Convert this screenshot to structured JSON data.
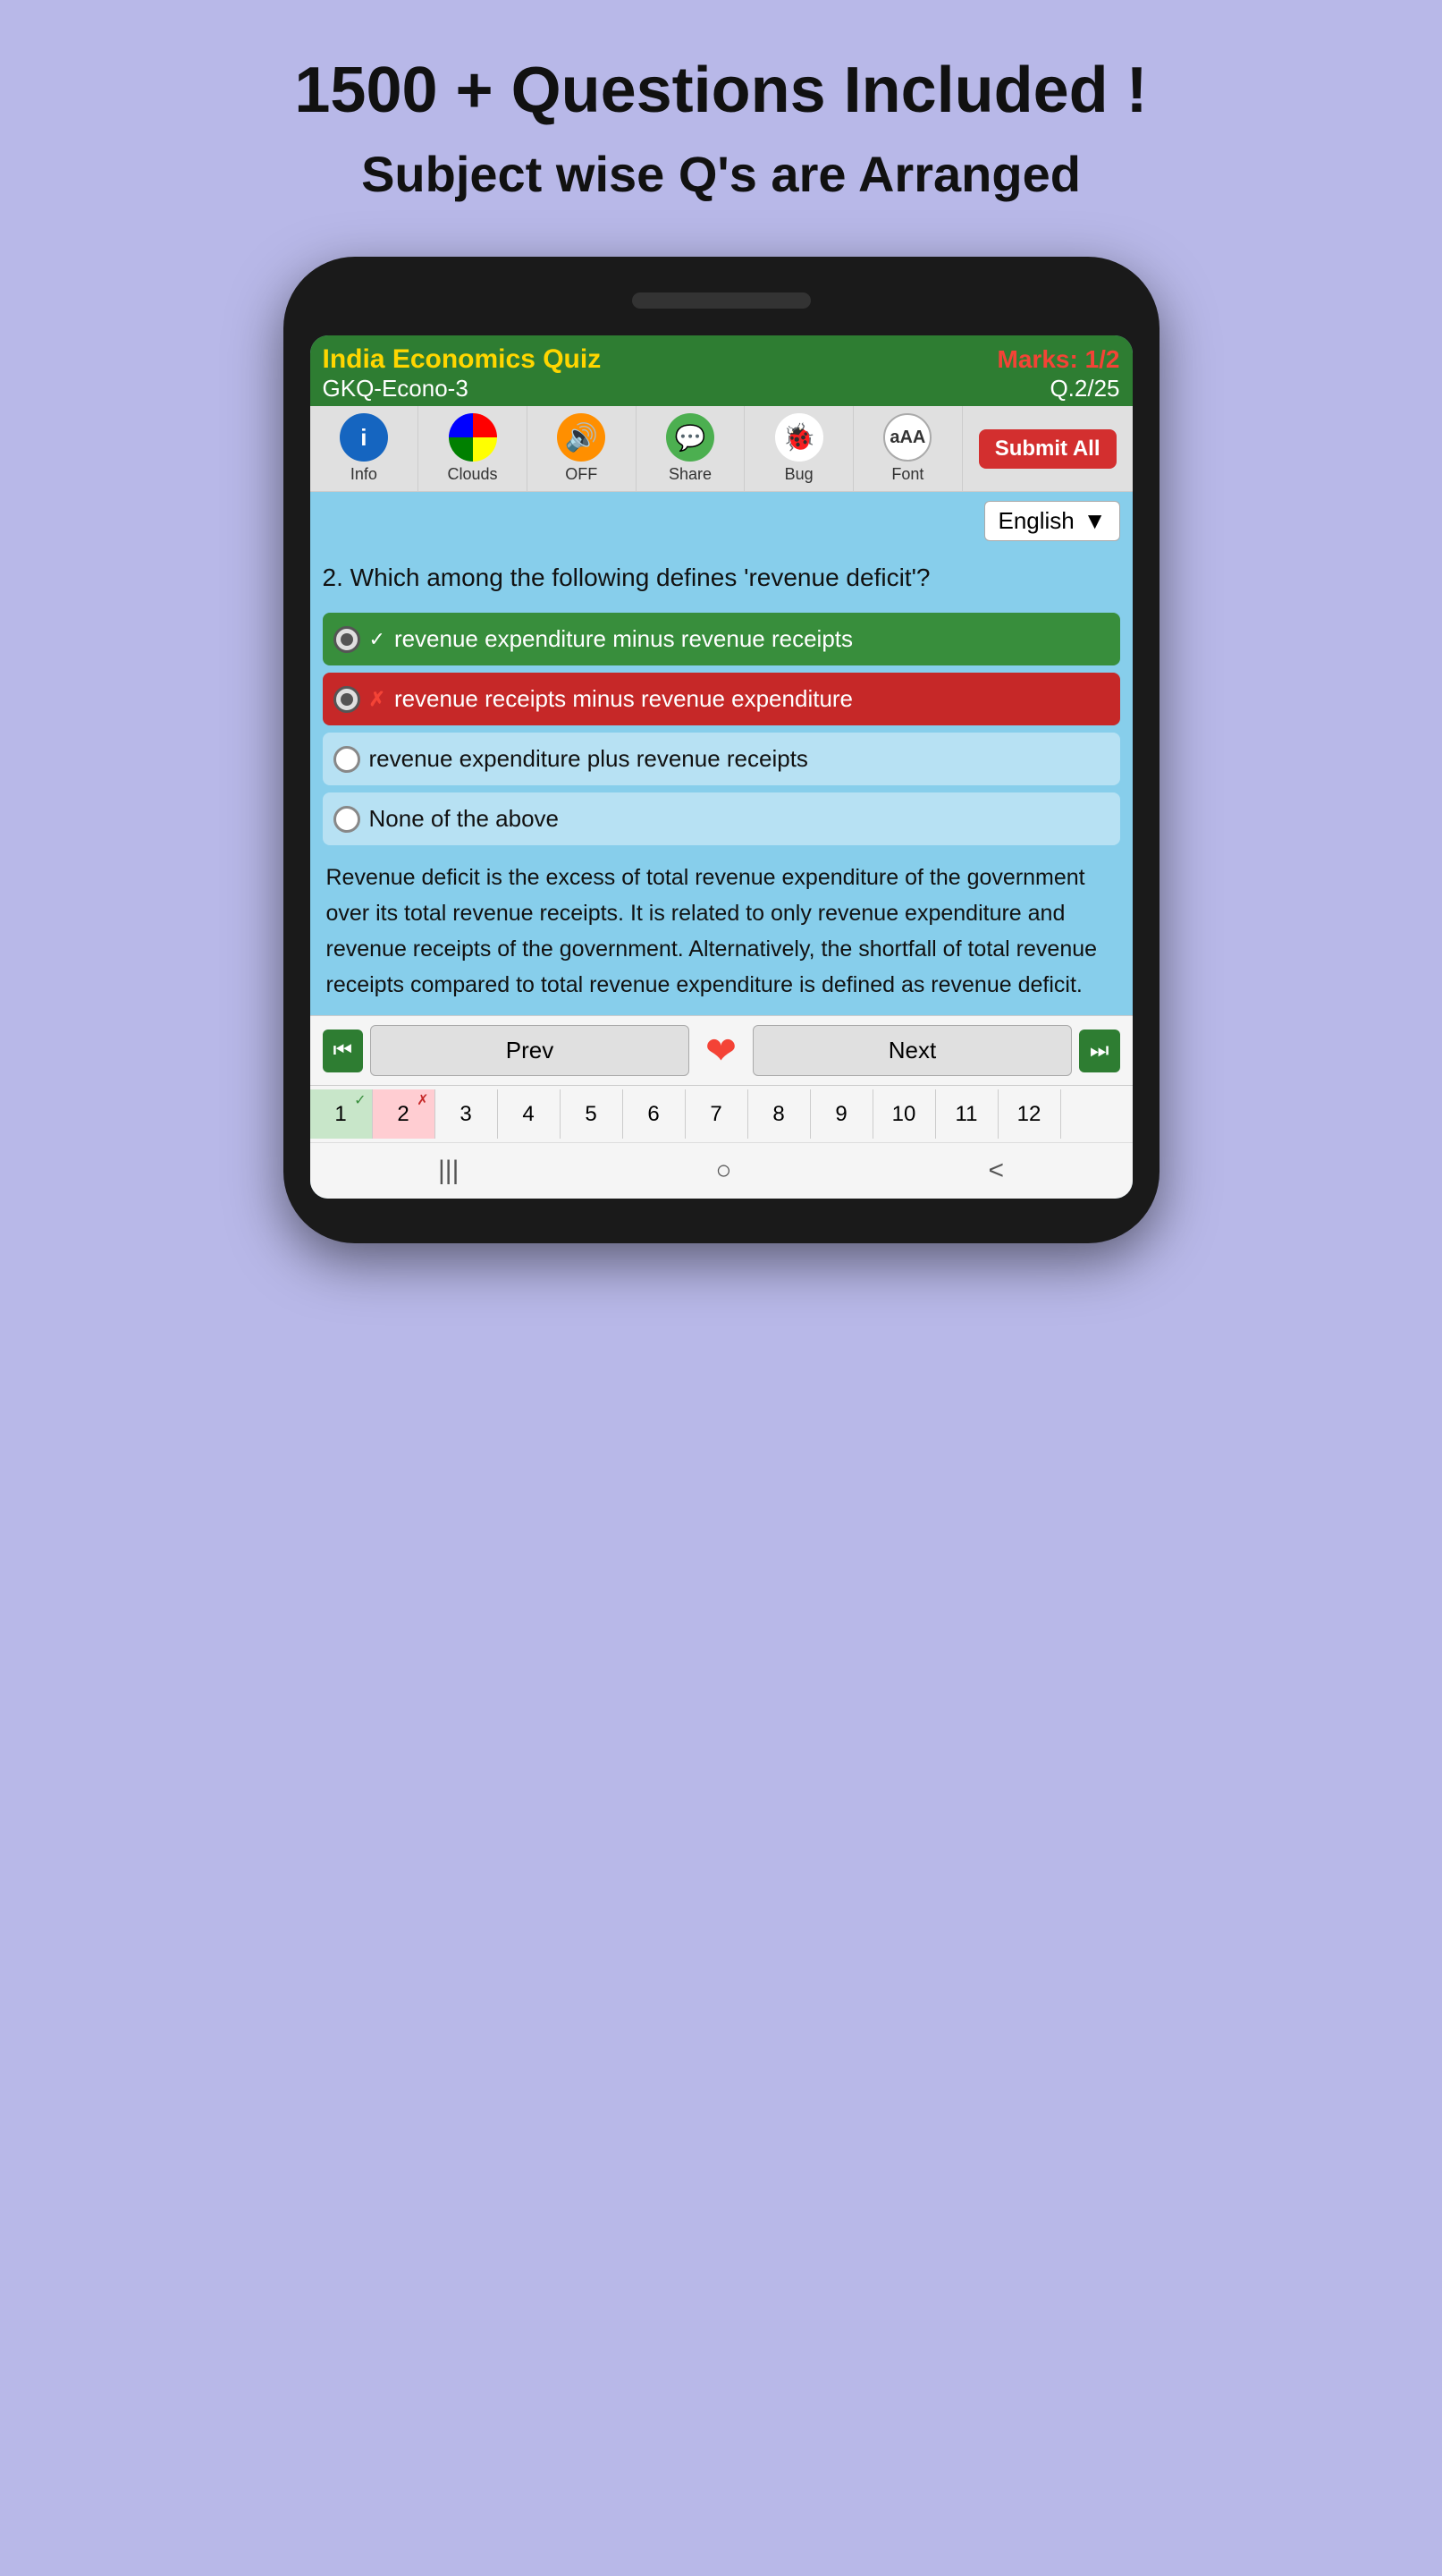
{
  "page": {
    "title": "1500 + Questions Included !",
    "subtitle": "Subject wise Q's are Arranged"
  },
  "header": {
    "quiz_title": "India Economics Quiz",
    "marks_label": "Marks: 1/2",
    "quiz_code": "GKQ-Econo-3",
    "q_progress": "Q.2/25"
  },
  "toolbar": {
    "items": [
      {
        "id": "info",
        "label": "Info"
      },
      {
        "id": "clouds",
        "label": "Clouds"
      },
      {
        "id": "off",
        "label": "OFF"
      },
      {
        "id": "share",
        "label": "Share"
      },
      {
        "id": "bug",
        "label": "Bug"
      },
      {
        "id": "font",
        "label": "Font"
      }
    ],
    "submit_label": "Submit All"
  },
  "language": {
    "selected": "English"
  },
  "question": {
    "number": "2",
    "text": "Which among the following defines 'revenue deficit'?",
    "options": [
      {
        "id": "a",
        "text": "revenue expenditure minus revenue receipts",
        "state": "correct"
      },
      {
        "id": "b",
        "text": "revenue receipts minus revenue expenditure",
        "state": "wrong"
      },
      {
        "id": "c",
        "text": "revenue expenditure plus revenue receipts",
        "state": "neutral"
      },
      {
        "id": "d",
        "text": "None of the above",
        "state": "neutral"
      }
    ],
    "explanation": "Revenue deficit is the excess of total revenue expenditure of the government over its total revenue receipts. It is related to only revenue expenditure and revenue receipts of the government. Alternatively, the shortfall of total revenue receipts compared to total revenue expenditure is defined as revenue deficit."
  },
  "nav": {
    "prev_label": "Prev",
    "next_label": "Next"
  },
  "qnums": [
    {
      "num": "1",
      "state": "correct",
      "indicator": "✓"
    },
    {
      "num": "2",
      "state": "wrong",
      "indicator": "✗"
    },
    {
      "num": "3",
      "state": "neutral"
    },
    {
      "num": "4",
      "state": "neutral"
    },
    {
      "num": "5",
      "state": "neutral"
    },
    {
      "num": "6",
      "state": "neutral"
    },
    {
      "num": "7",
      "state": "neutral"
    },
    {
      "num": "8",
      "state": "neutral"
    },
    {
      "num": "9",
      "state": "neutral"
    },
    {
      "num": "10",
      "state": "neutral"
    },
    {
      "num": "11",
      "state": "neutral"
    },
    {
      "num": "12",
      "state": "neutral"
    }
  ]
}
